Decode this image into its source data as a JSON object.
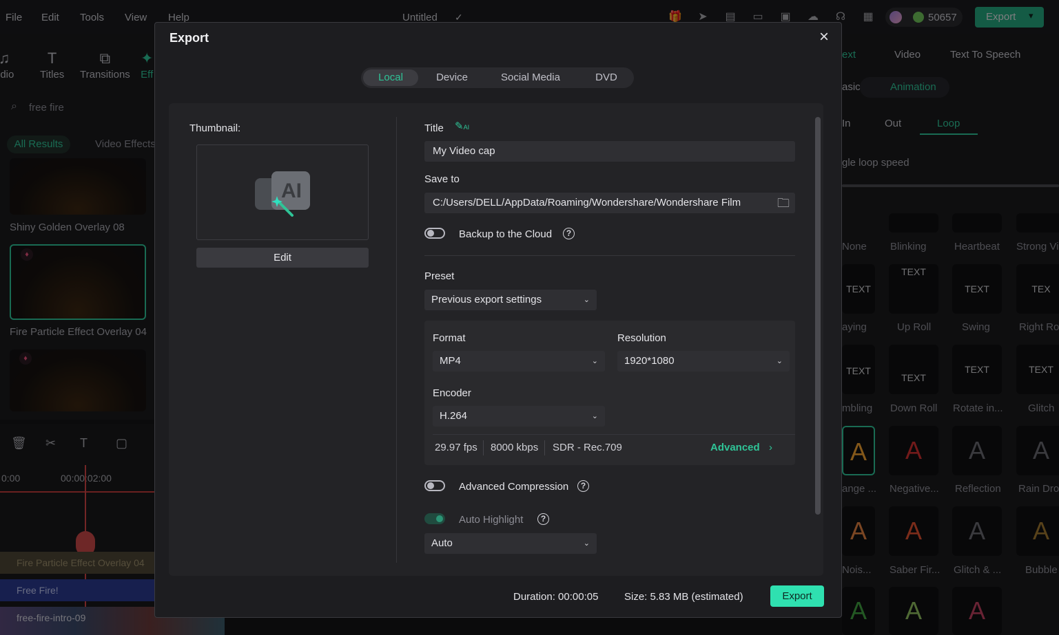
{
  "menu": [
    "File",
    "Edit",
    "Tools",
    "View",
    "Help"
  ],
  "project": {
    "title": "Untitled"
  },
  "header": {
    "credits": "50657",
    "export_label": "Export"
  },
  "tools": [
    "udio",
    "Titles",
    "Transitions",
    "Eff"
  ],
  "media": {
    "search_value": "free fire",
    "filters": [
      "All Results",
      "Video Effects"
    ],
    "items": [
      "Shiny Golden Overlay 08",
      "Fire Particle Effect Overlay 04"
    ]
  },
  "timeline": {
    "t0": "0:00",
    "t1": "00:00:02:00",
    "tracks": [
      "Fire Particle Effect Overlay 04",
      "Free Fire!",
      "free-fire-intro-09"
    ]
  },
  "right": {
    "tabs": [
      "ext",
      "Video",
      "Text To Speech"
    ],
    "sub": [
      "asic",
      "Animation"
    ],
    "anim": [
      "In",
      "Out",
      "Loop"
    ],
    "loop_speed": "gle loop speed",
    "effects": [
      "None",
      "Blinking",
      "Heartbeat",
      "Strong Vi",
      "aying",
      "Up Roll",
      "Swing",
      "Right Ro",
      "mbling",
      "Down Roll",
      "Rotate in...",
      "Glitch",
      "ange ...",
      "Negative...",
      "Reflection",
      "Rain Dro",
      "Nois...",
      "Saber Fir...",
      "Glitch & ...",
      "Bubble"
    ]
  },
  "dialog": {
    "title": "Export",
    "tabs": [
      "Local",
      "Device",
      "Social Media",
      "DVD"
    ],
    "thumbnail_label": "Thumbnail:",
    "edit_label": "Edit",
    "title_label": "Title",
    "title_value": "My Video cap",
    "save_to_label": "Save to",
    "save_path": "C:/Users/DELL/AppData/Roaming/Wondershare/Wondershare Film",
    "backup_label": "Backup to the Cloud",
    "preset_label": "Preset",
    "preset_value": "Previous export settings",
    "format_label": "Format",
    "format_value": "MP4",
    "resolution_label": "Resolution",
    "resolution_value": "1920*1080",
    "encoder_label": "Encoder",
    "encoder_value": "H.264",
    "fps": "29.97 fps",
    "bitrate": "8000 kbps",
    "color_space": "SDR - Rec.709",
    "advanced_label": "Advanced",
    "compression_label": "Advanced Compression",
    "highlight_label": "Auto Highlight",
    "highlight_value": "Auto",
    "duration": "Duration: 00:00:05",
    "size": "Size:  5.83 MB (estimated)",
    "export_label": "Export"
  },
  "colors": {
    "accent": "#2fc497",
    "export_button": "#2fe0b0",
    "dialog_bg": "#1d1d20"
  }
}
